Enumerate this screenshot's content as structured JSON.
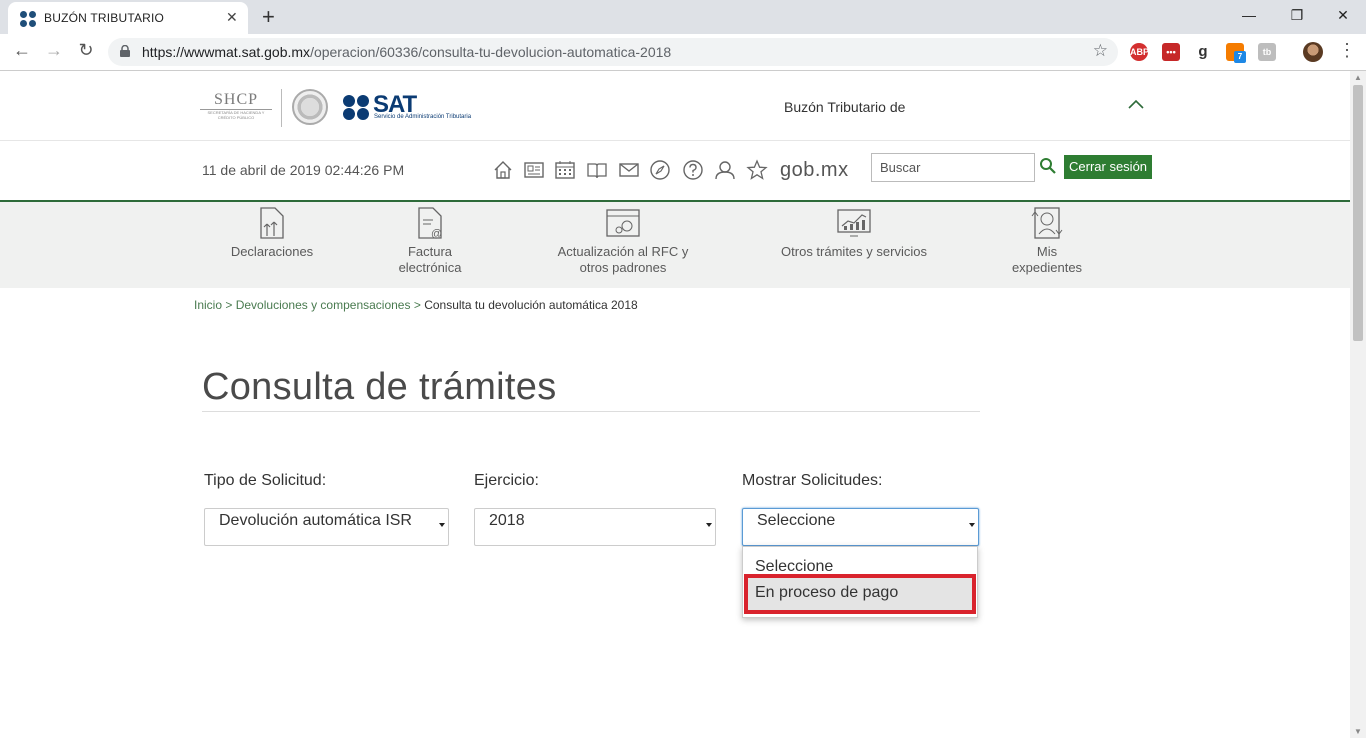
{
  "browser": {
    "tab_title": "BUZÓN TRIBUTARIO",
    "url_host": "https://wwwmat.sat.gob.mx",
    "url_path": "/operacion/60336/consulta-tu-devolucion-automatica-2018",
    "extensions": [
      "ABP",
      "•••",
      "g",
      "7",
      "tb"
    ]
  },
  "header": {
    "shcp_logo": "SHCP",
    "shcp_sub": "SECRETARÍA DE HACIENDA Y CRÉDITO PÚBLICO",
    "sat_logo": "SAT",
    "sat_sub": "Servicio de Administración Tributaria",
    "buzon_label": "Buzón Tributario de"
  },
  "toolbar": {
    "datetime": "11 de abril de 2019 02:44:26 PM",
    "gobmx": "gob.mx",
    "search_placeholder": "Buscar",
    "logout_label": "Cerrar sesión"
  },
  "nav": {
    "items": [
      {
        "l1": "Declaraciones",
        "l2": ""
      },
      {
        "l1": "Factura",
        "l2": "electrónica"
      },
      {
        "l1": "Actualización al RFC y",
        "l2": "otros padrones"
      },
      {
        "l1": "Otros trámites y servicios",
        "l2": ""
      },
      {
        "l1": "Mis",
        "l2": "expedientes"
      }
    ]
  },
  "breadcrumb": {
    "home": "Inicio",
    "sep": ">",
    "section": "Devoluciones y compensaciones",
    "current": "Consulta tu devolución automática 2018"
  },
  "main": {
    "title": "Consulta de trámites",
    "filters": [
      {
        "label": "Tipo de Solicitud:",
        "value": "Devolución automática ISR"
      },
      {
        "label": "Ejercicio:",
        "value": "2018"
      },
      {
        "label": "Mostrar Solicitudes:",
        "value": "Seleccione"
      }
    ],
    "dropdown_options": [
      "Seleccione",
      "En proceso de pago"
    ]
  },
  "colors": {
    "accent_green": "#2e7d32",
    "highlight_red": "#d9232d",
    "sat_blue": "#0b3b73"
  }
}
